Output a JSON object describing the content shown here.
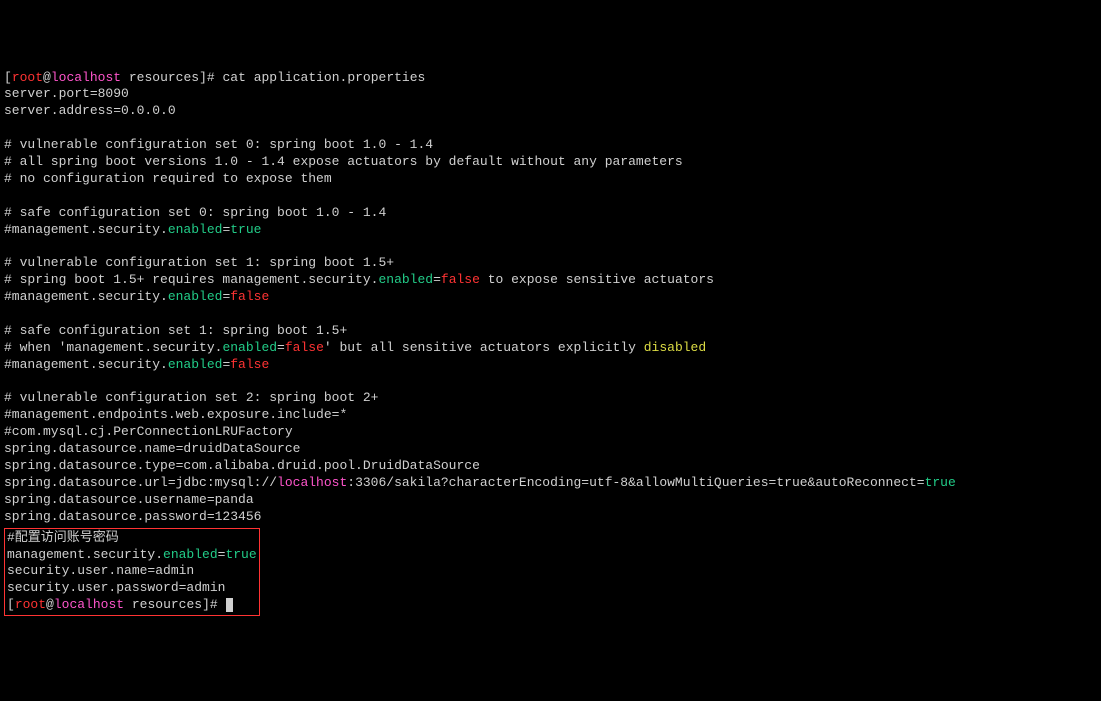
{
  "prompt1": {
    "bracket_open": "[",
    "user": "root",
    "at": "@",
    "host": "localhost",
    "space": " ",
    "dir": "resources",
    "bracket_close": "]# ",
    "cmd": "cat application.properties"
  },
  "lines": {
    "l1": "server.port=8090",
    "l2": "server.address=0.0.0.0",
    "l3": "",
    "l4": "# vulnerable configuration set 0: spring boot 1.0 - 1.4",
    "l5": "# all spring boot versions 1.0 - 1.4 expose actuators by default without any parameters",
    "l6": "# no configuration required to expose them",
    "l7": "",
    "l8": "# safe configuration set 0: spring boot 1.0 - 1.4",
    "l9a": "#management.security.",
    "l9b": "enabled",
    "l9c": "=",
    "l9d": "true",
    "l10": "",
    "l11": "# vulnerable configuration set 1: spring boot 1.5+",
    "l12a": "# spring boot 1.5+ requires management.security.",
    "l12b": "enabled",
    "l12c": "=",
    "l12d": "false",
    "l12e": " to expose sensitive actuators",
    "l13a": "#management.security.",
    "l13b": "enabled",
    "l13c": "=",
    "l13d": "false",
    "l14": "",
    "l15": "# safe configuration set 1: spring boot 1.5+",
    "l16a": "# when 'management.security.",
    "l16b": "enabled",
    "l16c": "=",
    "l16d": "false",
    "l16e": "' but all sensitive actuators explicitly ",
    "l16f": "disabled",
    "l17a": "#management.security.",
    "l17b": "enabled",
    "l17c": "=",
    "l17d": "false",
    "l18": "",
    "l19": "# vulnerable configuration set 2: spring boot 2+",
    "l20": "#management.endpoints.web.exposure.include=*",
    "l21": "#com.mysql.cj.PerConnectionLRUFactory",
    "l22": "spring.datasource.name=druidDataSource",
    "l23": "spring.datasource.type=com.alibaba.druid.pool.DruidDataSource",
    "l24a": "spring.datasource.url=jdbc:mysql://",
    "l24b": "localhost",
    "l24c": ":3306/sakila?characterEncoding=utf-8&allowMultiQueries=true&autoReconnect=",
    "l24d": "true",
    "l25": "spring.datasource.username=panda",
    "l26": "spring.datasource.password=123456"
  },
  "box": {
    "b1": "#配置访问账号密码",
    "b2a": "management.security.",
    "b2b": "enabled",
    "b2c": "=",
    "b2d": "true",
    "b3": "security.user.name=admin",
    "b4": "security.user.password=admin"
  },
  "prompt2": {
    "bracket_open": "[",
    "user": "root",
    "at": "@",
    "host": "localhost",
    "space": " ",
    "dir": "resources",
    "bracket_close": "]# "
  }
}
